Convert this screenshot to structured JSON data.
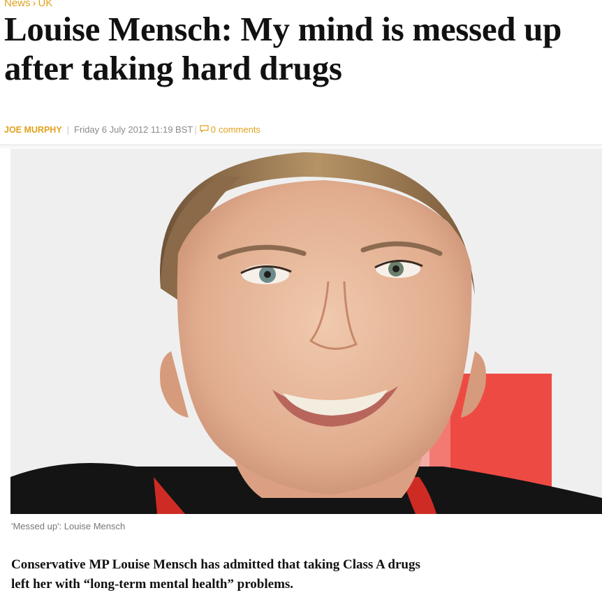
{
  "breadcrumb": {
    "section": "News",
    "separator": "›",
    "subsection": "UK"
  },
  "article": {
    "headline": "Louise Mensch: My mind is messed up after taking hard drugs",
    "author": "JOE MURPHY",
    "date": "Friday 6 July 2012 11:19 BST",
    "comment_count": "0",
    "comment_label": "comments",
    "image_caption": "'Messed up': Louise Mensch",
    "lead": "Conservative MP Louise Mensch has admitted that taking Class A drugs left her with “long-term mental health” problems."
  },
  "colors": {
    "accent": "#e0a21d",
    "meta_text": "#8a8a8a",
    "headline": "#111111"
  },
  "icons": {
    "comments": "speech-bubble-icon"
  }
}
